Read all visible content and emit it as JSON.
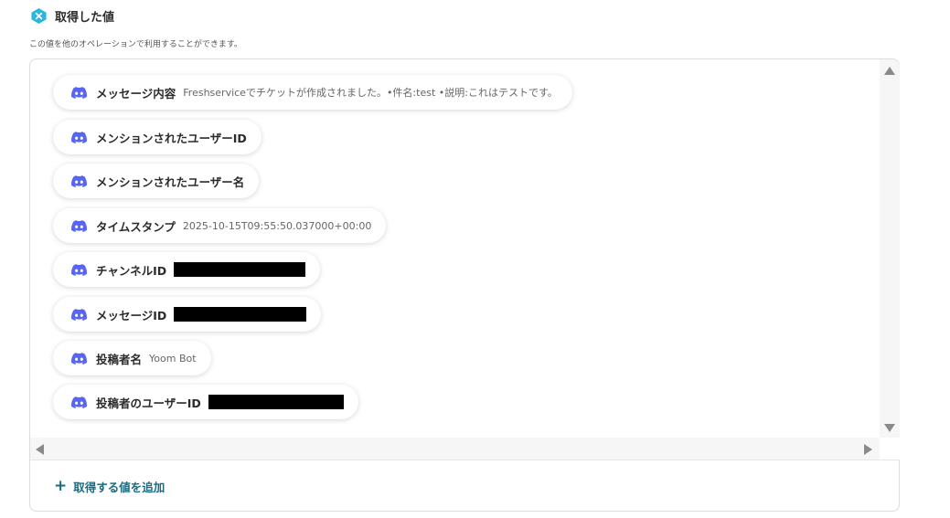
{
  "header": {
    "title": "取得した値",
    "icon": "x-badge-icon",
    "icon_color": "#29b6e0"
  },
  "subtitle": "この値を他のオペレーションで利用することができます。",
  "items": [
    {
      "label": "メッセージ内容",
      "value": "Freshserviceでチケットが作成されました。•件名:test •説明:これはテストです。"
    },
    {
      "label": "メンションされたユーザーID",
      "value": ""
    },
    {
      "label": "メンションされたユーザー名",
      "value": ""
    },
    {
      "label": "タイムスタンプ",
      "value": "2025-10-15T09:55:50.037000+00:00"
    },
    {
      "label": "チャンネルID",
      "value": "",
      "redacted": true
    },
    {
      "label": "メッセージID",
      "value": "",
      "redacted": true
    },
    {
      "label": "投稿者名",
      "value": "Yoom Bot"
    },
    {
      "label": "投稿者のユーザーID",
      "value": "",
      "redacted": true
    }
  ],
  "item_icon": "discord-icon",
  "discord_color": "#5865f2",
  "accent_color": "#1a6a80",
  "add_button": {
    "icon": "plus-icon",
    "label": "取得する値を追加"
  }
}
